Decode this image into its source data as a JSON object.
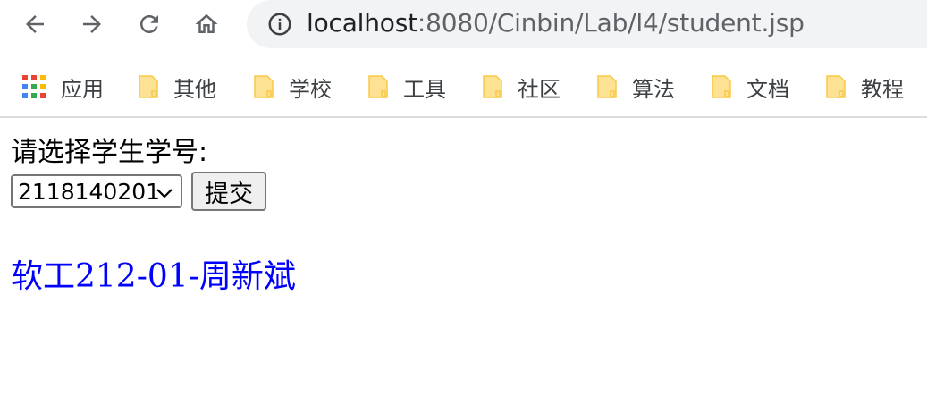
{
  "browser": {
    "url_host": "localhost",
    "url_path": ":8080/Cinbin/Lab/l4/student.jsp",
    "icons": {
      "back": "arrow-left-icon",
      "forward": "arrow-right-icon",
      "reload": "reload-icon",
      "home": "home-icon",
      "info": "info-icon"
    }
  },
  "bookmarks": {
    "apps_label": "应用",
    "items": [
      {
        "label": "其他"
      },
      {
        "label": "学校"
      },
      {
        "label": "工具"
      },
      {
        "label": "社区"
      },
      {
        "label": "算法"
      },
      {
        "label": "文档"
      },
      {
        "label": "教程"
      }
    ]
  },
  "page": {
    "prompt": "请选择学生学号:",
    "select_value": "2118140201",
    "submit_label": "提交",
    "result_text": "软工212-01-周新斌",
    "result_color": "#0000ff"
  }
}
